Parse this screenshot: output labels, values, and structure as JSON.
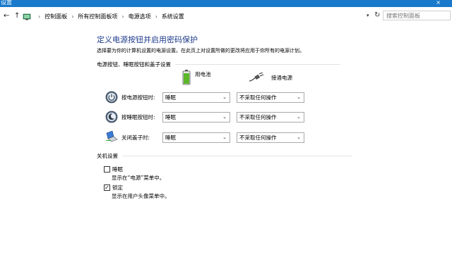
{
  "window": {
    "title": "设置",
    "close_glyph": "×"
  },
  "nav": {
    "back": "←",
    "forward": "→",
    "up": "↑",
    "refresh": "↻"
  },
  "breadcrumbs": [
    "控制面板",
    "所有控制面板项",
    "电源选项",
    "系统设置"
  ],
  "breadcrumb_sep": "›",
  "search": {
    "placeholder": "搜索控制面板"
  },
  "page": {
    "title": "定义电源按钮并启用密码保护",
    "description": "选择要为你的计算机设置的电源设置。在此页上对设置所做的更改将应用于你所有的电源计划。"
  },
  "power_section": {
    "heading": "电源按钮、睡眠按钮和盖子设置",
    "columns": {
      "battery": "用电池",
      "plugged": "接通电源"
    },
    "rows": [
      {
        "label": "按电源按钮时:",
        "icon": "power-button-icon",
        "battery": "睡眠",
        "plugged": "不采取任何操作"
      },
      {
        "label": "按睡眠按钮时:",
        "icon": "sleep-button-icon",
        "battery": "睡眠",
        "plugged": "不采取任何操作"
      },
      {
        "label": "关闭盖子时:",
        "icon": "laptop-lid-icon",
        "battery": "睡眠",
        "plugged": "不采取任何操作"
      }
    ]
  },
  "shutdown_section": {
    "heading": "关机设置",
    "items": [
      {
        "label": "睡眠",
        "checked": false,
        "check_glyph": "",
        "description": "显示在“电源”菜单中。"
      },
      {
        "label": "锁定",
        "checked": true,
        "check_glyph": "✓",
        "description": "显示在用户头像菜单中。"
      }
    ]
  },
  "colors": {
    "titlebar": "#1979ca",
    "title_text": "#1f3b8c",
    "battery_green": "#5cb82a"
  }
}
